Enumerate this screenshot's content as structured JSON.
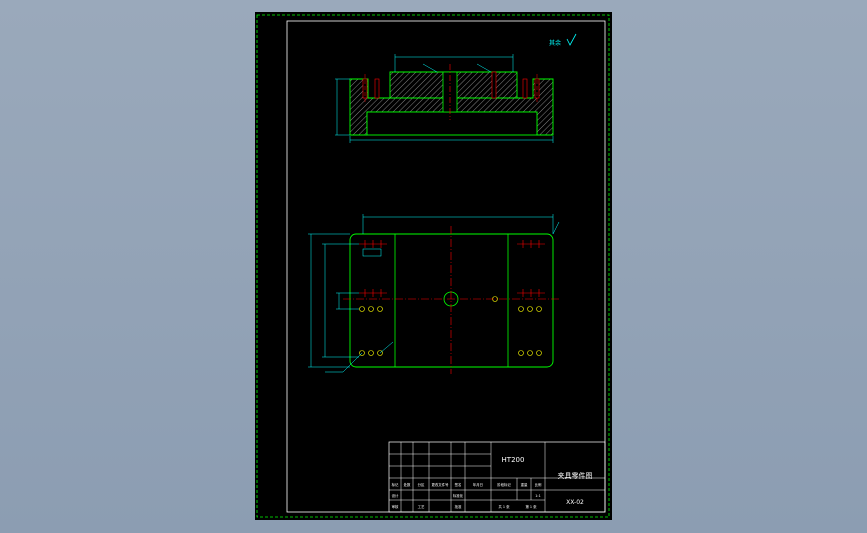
{
  "drawing": {
    "surface_finish_note": "其余",
    "material": "HT200",
    "title_block": {
      "part_title": "夹具零件图",
      "row_marks": [
        "标记",
        "处数",
        "分区",
        "更改文件号",
        "签名",
        "年月日"
      ],
      "design_label": "设计",
      "standardize_label": "标准化",
      "review_label": "审核",
      "process_label": "工艺",
      "approve_label": "批准",
      "stage_label": "阶段标记",
      "weight_label": "重量",
      "scale_label": "比例",
      "scale_value": "1:1",
      "sheet_text": "共 1 张",
      "sheet_index": "第 1 张",
      "drawing_number": "XX-02"
    }
  },
  "colors": {
    "frame": "#00ff00",
    "outline": "#00ff00",
    "dimension": "#00ffff",
    "centerline": "#ff0000",
    "hidden": "#ffff00",
    "hatch": "#c8c8c8",
    "text": "#ffffff"
  }
}
